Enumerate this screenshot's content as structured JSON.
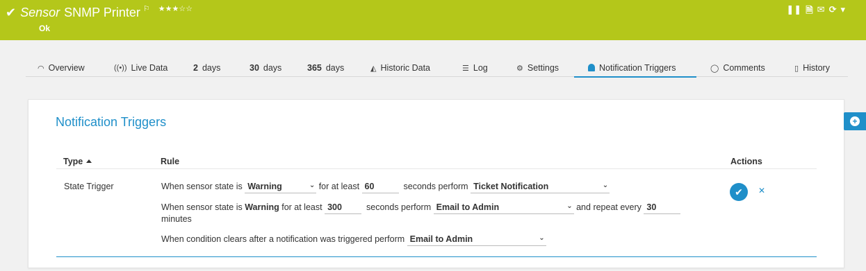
{
  "header": {
    "sensor_word": "Sensor",
    "name": "SNMP Printer",
    "stars": "★★★☆☆",
    "status": "Ok",
    "icons": [
      "pause-icon",
      "report-icon",
      "email-icon",
      "refresh-icon",
      "dropdown-icon"
    ]
  },
  "tabs": [
    {
      "label": "Overview",
      "icon": "gauge-icon"
    },
    {
      "label": "Live Data",
      "icon": "broadcast-icon"
    },
    {
      "num": "2",
      "unit": "days"
    },
    {
      "num": "30",
      "unit": "days"
    },
    {
      "num": "365",
      "unit": "days"
    },
    {
      "label": "Historic Data",
      "icon": "area-chart-icon"
    },
    {
      "label": "Log",
      "icon": "list-icon"
    },
    {
      "label": "Settings",
      "icon": "gear-icon"
    },
    {
      "label": "Notification Triggers",
      "icon": "bell-icon",
      "active": true
    },
    {
      "label": "Comments",
      "icon": "comment-icon"
    },
    {
      "label": "History",
      "icon": "history-icon"
    }
  ],
  "panel": {
    "title": "Notification Triggers",
    "columns": {
      "type": "Type",
      "rule": "Rule",
      "actions": "Actions"
    },
    "row": {
      "type": "State Trigger",
      "line1": {
        "prefix": "When sensor state is",
        "state": "Warning",
        "for_at_least": "for at least",
        "seconds": "60",
        "seconds_perform": "seconds perform",
        "action": "Ticket Notification"
      },
      "line2": {
        "prefix": "When sensor state is",
        "state": "Warning",
        "for_at_least": "for at least",
        "seconds": "300",
        "seconds_perform": "seconds perform",
        "action": "Email to Admin",
        "repeat": "and repeat every",
        "repeat_value": "30",
        "minutes": "minutes"
      },
      "line3": {
        "text": "When condition clears after a notification was triggered perform",
        "action": "Email to Admin"
      }
    }
  },
  "colors": {
    "header": "#b4c71a",
    "accent": "#1f8fc9"
  }
}
